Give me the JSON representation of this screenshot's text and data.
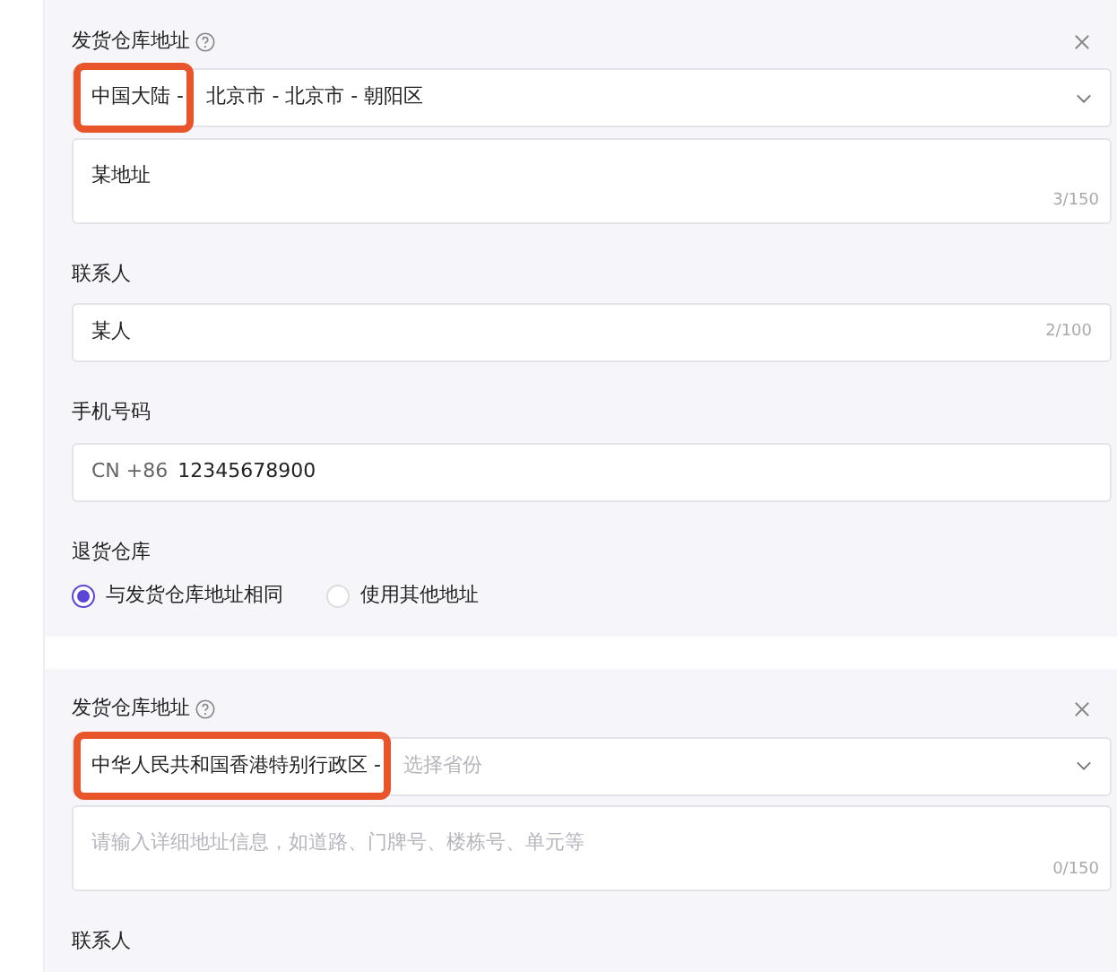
{
  "sections": [
    {
      "title": "发货仓库地址",
      "region": {
        "parts": [
          {
            "text": "中国大陆 -",
            "placeholder": false,
            "highlighted": true
          },
          {
            "text": "北京市 - 北京市 - 朝阳区",
            "placeholder": false,
            "highlighted": false
          }
        ]
      },
      "address": {
        "value": "某地址",
        "counter": "3/150"
      },
      "contact": {
        "label": "联系人",
        "value": "某人",
        "counter": "2/100"
      },
      "phone": {
        "label": "手机号码",
        "prefix": "CN +86",
        "value": "12345678900"
      },
      "return": {
        "label": "退货仓库",
        "options": [
          {
            "label": "与发货仓库地址相同",
            "selected": true
          },
          {
            "label": "使用其他地址",
            "selected": false
          }
        ]
      }
    },
    {
      "title": "发货仓库地址",
      "region": {
        "parts": [
          {
            "text": "中华人民共和国香港特别行政区 -",
            "placeholder": false,
            "highlighted": true
          },
          {
            "text": "选择省份",
            "placeholder": true,
            "highlighted": false
          }
        ]
      },
      "address": {
        "placeholder": "请输入详细地址信息，如道路、门牌号、楼栋号、单元等",
        "counter": "0/150"
      },
      "contact": {
        "label": "联系人"
      }
    }
  ]
}
